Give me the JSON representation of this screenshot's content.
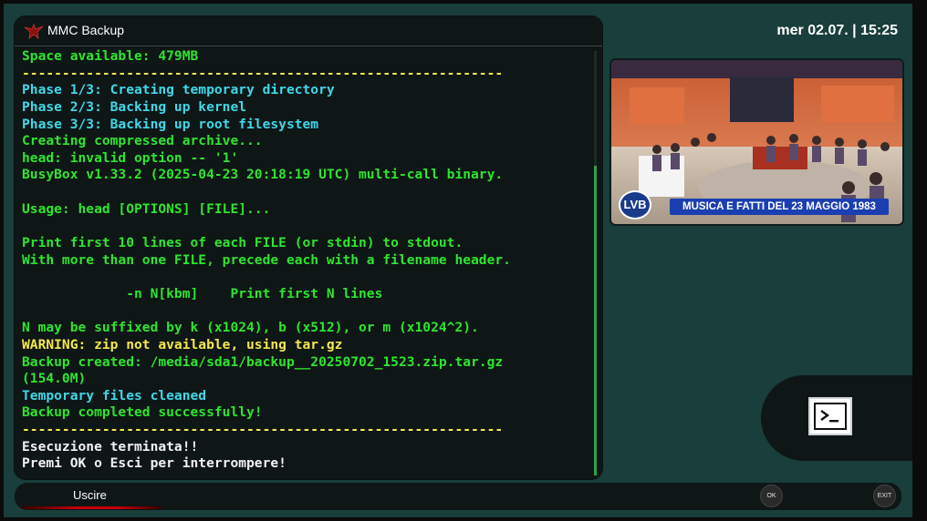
{
  "window": {
    "title": "MMC Backup",
    "icon": "bird-logo-icon"
  },
  "clock": {
    "text": "mer 02.07. | 15:25"
  },
  "console": {
    "lines": [
      {
        "text": "Space available: 479MB",
        "color": "#2ee52e"
      },
      {
        "text": "------------------------------------------------------------",
        "color": "#f2e84a"
      },
      {
        "text": "Phase 1/3: Creating temporary directory",
        "color": "#3fd8e8"
      },
      {
        "text": "Phase 2/3: Backing up kernel",
        "color": "#3fd8e8"
      },
      {
        "text": "Phase 3/3: Backing up root filesystem",
        "color": "#3fd8e8"
      },
      {
        "text": "Creating compressed archive...",
        "color": "#2ee52e"
      },
      {
        "text": "head: invalid option -- '1'",
        "color": "#2ee52e"
      },
      {
        "text": "BusyBox v1.33.2 (2025-04-23 20:18:19 UTC) multi-call binary.",
        "color": "#2ee52e"
      },
      {
        "text": "",
        "color": "#2ee52e"
      },
      {
        "text": "Usage: head [OPTIONS] [FILE]...",
        "color": "#2ee52e"
      },
      {
        "text": "",
        "color": "#2ee52e"
      },
      {
        "text": "Print first 10 lines of each FILE (or stdin) to stdout.",
        "color": "#2ee52e"
      },
      {
        "text": "With more than one FILE, precede each with a filename header.",
        "color": "#2ee52e"
      },
      {
        "text": "",
        "color": "#2ee52e"
      },
      {
        "text": "             -n N[kbm]    Print first N lines",
        "color": "#2ee52e"
      },
      {
        "text": "",
        "color": "#2ee52e"
      },
      {
        "text": "N may be suffixed by k (x1024), b (x512), or m (x1024^2).",
        "color": "#2ee52e"
      },
      {
        "text": "WARNING: zip not available, using tar.gz",
        "color": "#f2e84a"
      },
      {
        "text": "Backup created: /media/sda1/backup__20250702_1523.zip.tar.gz",
        "color": "#2ee52e"
      },
      {
        "text": "(154.0M)",
        "color": "#2ee52e"
      },
      {
        "text": "Temporary files cleaned",
        "color": "#3fd8e8"
      },
      {
        "text": "Backup completed successfully!",
        "color": "#2ee52e"
      },
      {
        "text": "------------------------------------------------------------",
        "color": "#f2e84a"
      },
      {
        "text": "Esecuzione terminata!!",
        "color": "#f2f2f2"
      },
      {
        "text": "Premi OK o Esci per interrompere!",
        "color": "#f2f2f2"
      }
    ]
  },
  "preview": {
    "channel_logo": "LVB",
    "caption": "MUSICA E FATTI DEL 23 MAGGIO 1983"
  },
  "terminal_button": {
    "icon": "terminal-icon"
  },
  "bottom_bar": {
    "exit_label": "Uscire",
    "ok_key": "OK",
    "exit_key": "EXIT"
  },
  "colors": {
    "background": "#193e3c",
    "console_bg": "#0e1616",
    "green": "#2ee52e",
    "cyan": "#3fd8e8",
    "yellow": "#f2e84a",
    "red_bar": "#c60000"
  }
}
